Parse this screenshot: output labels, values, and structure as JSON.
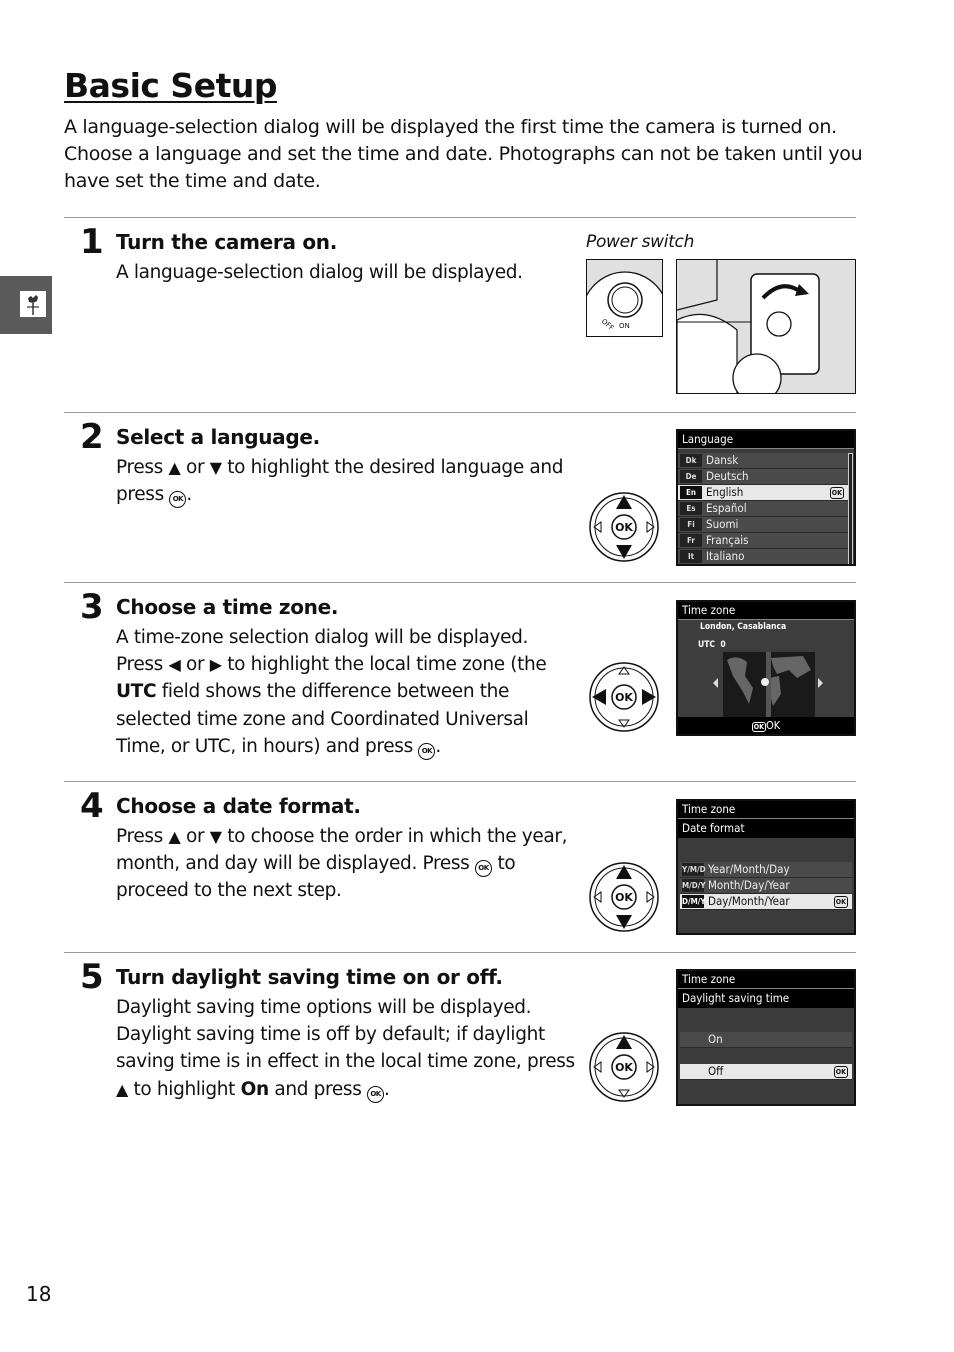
{
  "page": {
    "title": "Basic Setup",
    "intro": "A language-selection dialog will be displayed the first time the camera is turned on. Choose a language and set the time and date.  Photographs can not be taken until you have set the time and date.",
    "page_number": "18",
    "side_tab_icon": "weathervane-rooster-icon"
  },
  "glyphs": {
    "up": "▲",
    "down": "▼",
    "left": "◀",
    "right": "▶",
    "ok": "OK"
  },
  "steps": [
    {
      "number": "1",
      "title": "Turn the camera on.",
      "body": "A language-selection dialog will be displayed.",
      "figure_caption": "Power switch",
      "figure_labels": {
        "off": "OFF",
        "on": "ON"
      }
    },
    {
      "number": "2",
      "title": "Select a language.",
      "body_parts": {
        "p1": "Press ",
        "p2": " or ",
        "p3": " to highlight the desired language and press ",
        "p4": "."
      },
      "lcd": {
        "header": "Language",
        "rows": [
          {
            "code": "Dk",
            "label": "Dansk"
          },
          {
            "code": "De",
            "label": "Deutsch"
          },
          {
            "code": "En",
            "label": "English",
            "selected": true
          },
          {
            "code": "Es",
            "label": "Español"
          },
          {
            "code": "Fi",
            "label": "Suomi"
          },
          {
            "code": "Fr",
            "label": "Français"
          },
          {
            "code": "It",
            "label": "Italiano"
          }
        ],
        "ok_badge": "OK"
      }
    },
    {
      "number": "3",
      "title": "Choose a time zone.",
      "body_parts": {
        "p1": "A time-zone selection dialog will be displayed. Press ",
        "p2": " or ",
        "p3": " to highlight the local time zone (the ",
        "bold": "UTC",
        "p4": " field shows the difference between the selected time zone and Coordinated Universal Time, or UTC, in hours) and press ",
        "p5": "."
      },
      "lcd": {
        "header": "Time zone",
        "city": "London, Casablanca",
        "utc": "UTC  0",
        "footer_badge": "OK",
        "footer_label": "OK"
      }
    },
    {
      "number": "4",
      "title": "Choose a date format.",
      "body_parts": {
        "p1": "Press ",
        "p2": " or ",
        "p3": " to choose the order in which the year, month, and day will be displayed.  Press ",
        "p4": " to proceed to the next step."
      },
      "lcd": {
        "header": "Time zone",
        "sub": "Date format",
        "rows": [
          {
            "code": "Y/M/D",
            "label": "Year/Month/Day"
          },
          {
            "code": "M/D/Y",
            "label": "Month/Day/Year"
          },
          {
            "code": "D/M/Y",
            "label": "Day/Month/Year",
            "selected": true
          }
        ],
        "ok_badge": "OK"
      }
    },
    {
      "number": "5",
      "title": "Turn daylight saving time on or off.",
      "body_parts": {
        "p1": "Daylight saving time options will be displayed. Daylight saving time is off by default; if daylight saving time is in effect in the local time zone, press ",
        "p2": " to highlight ",
        "bold": "On",
        "p3": " and press ",
        "p4": "."
      },
      "lcd": {
        "header": "Time zone",
        "sub": "Daylight saving time",
        "rows": [
          {
            "label": "On"
          },
          {
            "label": "Off",
            "selected": true
          }
        ],
        "ok_badge": "OK"
      }
    }
  ]
}
